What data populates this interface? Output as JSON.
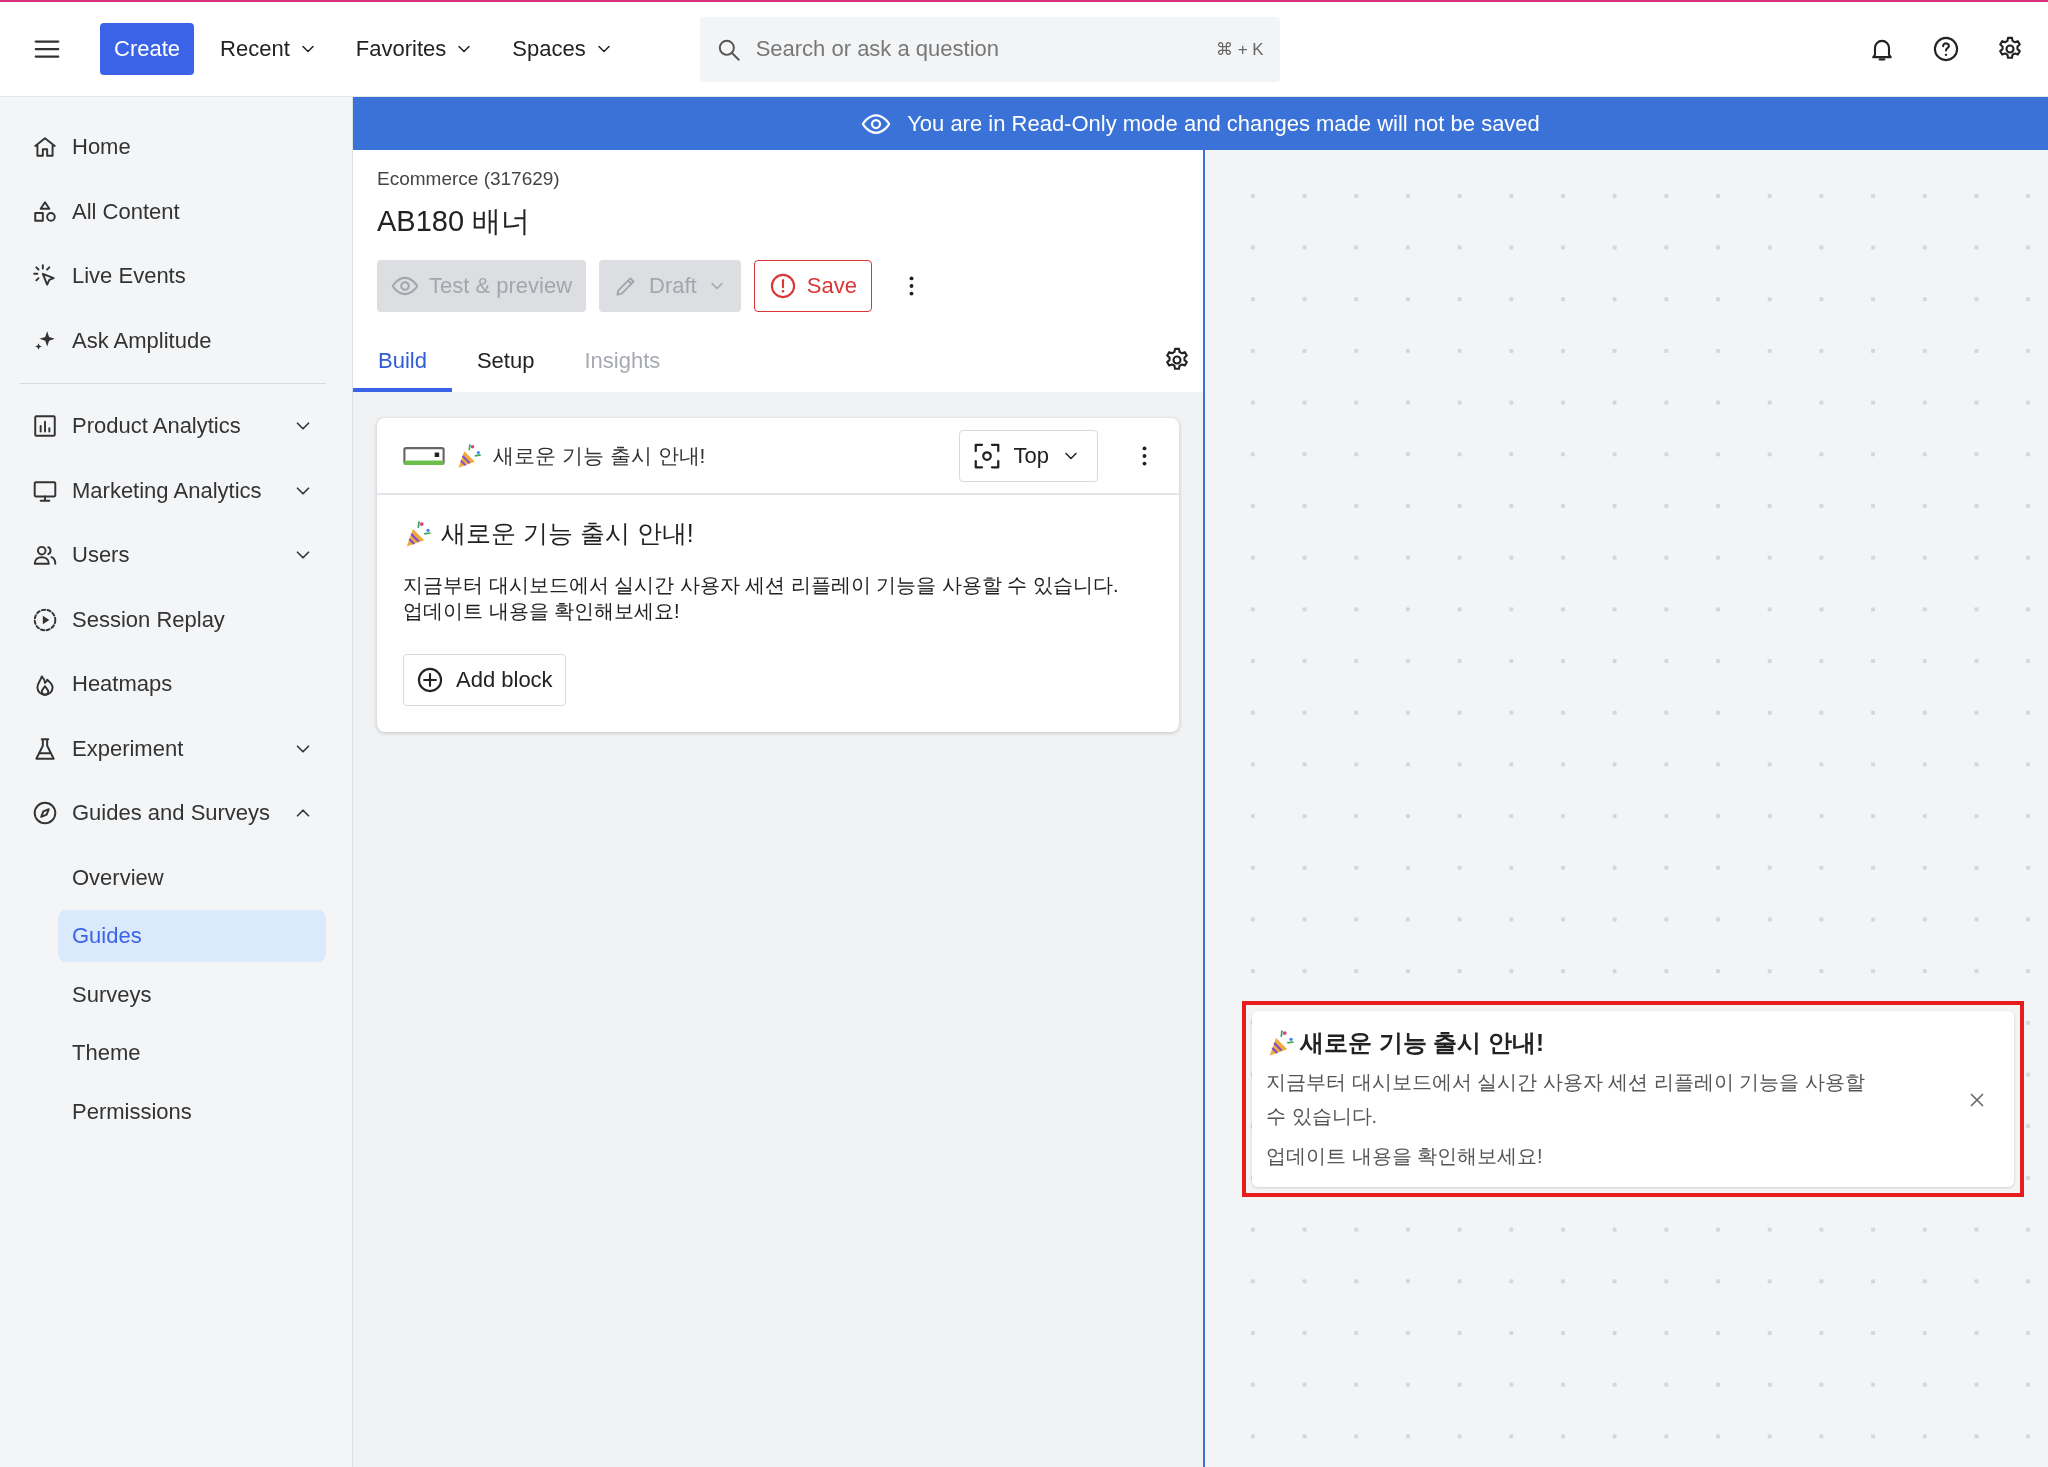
{
  "top_bar": {
    "create_button": "Create",
    "menus": [
      {
        "label": "Recent"
      },
      {
        "label": "Favorites"
      },
      {
        "label": "Spaces"
      }
    ],
    "search": {
      "placeholder": "Search or ask a question",
      "shortcut": "⌘ + K"
    }
  },
  "sidebar": {
    "items": [
      {
        "label": "Home",
        "expandable": false,
        "selected": false
      },
      {
        "label": "All Content",
        "expandable": false,
        "selected": false
      },
      {
        "label": "Live Events",
        "expandable": false,
        "selected": false
      },
      {
        "label": "Ask Amplitude",
        "expandable": false,
        "selected": false,
        "divider_after": true
      },
      {
        "label": "Product Analytics",
        "expandable": true,
        "expanded": false,
        "selected": false
      },
      {
        "label": "Marketing Analytics",
        "expandable": true,
        "expanded": false,
        "selected": false
      },
      {
        "label": "Users",
        "expandable": true,
        "expanded": false,
        "selected": false
      },
      {
        "label": "Session Replay",
        "expandable": false,
        "selected": false
      },
      {
        "label": "Heatmaps",
        "expandable": false,
        "selected": false
      },
      {
        "label": "Experiment",
        "expandable": true,
        "expanded": false,
        "selected": false
      },
      {
        "label": "Guides and Surveys",
        "expandable": true,
        "expanded": true,
        "selected": false,
        "children": [
          {
            "label": "Overview",
            "selected": false
          },
          {
            "label": "Guides",
            "selected": true
          },
          {
            "label": "Surveys",
            "selected": false
          },
          {
            "label": "Theme",
            "selected": false
          },
          {
            "label": "Permissions",
            "selected": false
          }
        ]
      }
    ]
  },
  "banner": {
    "text": "You are in Read-Only mode and changes made will not be saved"
  },
  "editor": {
    "project": "Ecommerce (317629)",
    "title": "AB180 배너",
    "actions": [
      {
        "kind": "preview",
        "label": "Test & preview",
        "disabled": true
      },
      {
        "kind": "status",
        "label": "Draft",
        "disabled": true
      },
      {
        "kind": "save",
        "label": "Save",
        "disabled": false
      }
    ],
    "tabs": [
      {
        "label": "Build",
        "selected": true,
        "disabled": false
      },
      {
        "label": "Setup",
        "selected": false,
        "disabled": false
      },
      {
        "label": "Insights",
        "selected": false,
        "disabled": true
      }
    ],
    "block": {
      "title": "새로운 기능 출시 안내!",
      "position": "Top",
      "heading": "새로운 기능 출시 안내!",
      "body": [
        "지금부터 대시보드에서 실시간 사용자 세션 리플레이 기능을 사용할 수 있습니다.",
        "업데이트 내용을 확인해보세요!"
      ],
      "add_block": "Add block"
    }
  },
  "preview": {
    "highlighted": true,
    "title": "새로운 기능 출시 안내!",
    "paragraphs": [
      "지금부터 대시보드에서 실시간 사용자 세션 리플레이 기능을 사용할 수 있습니다.",
      "업데이트 내용을 확인해보세요!"
    ]
  }
}
